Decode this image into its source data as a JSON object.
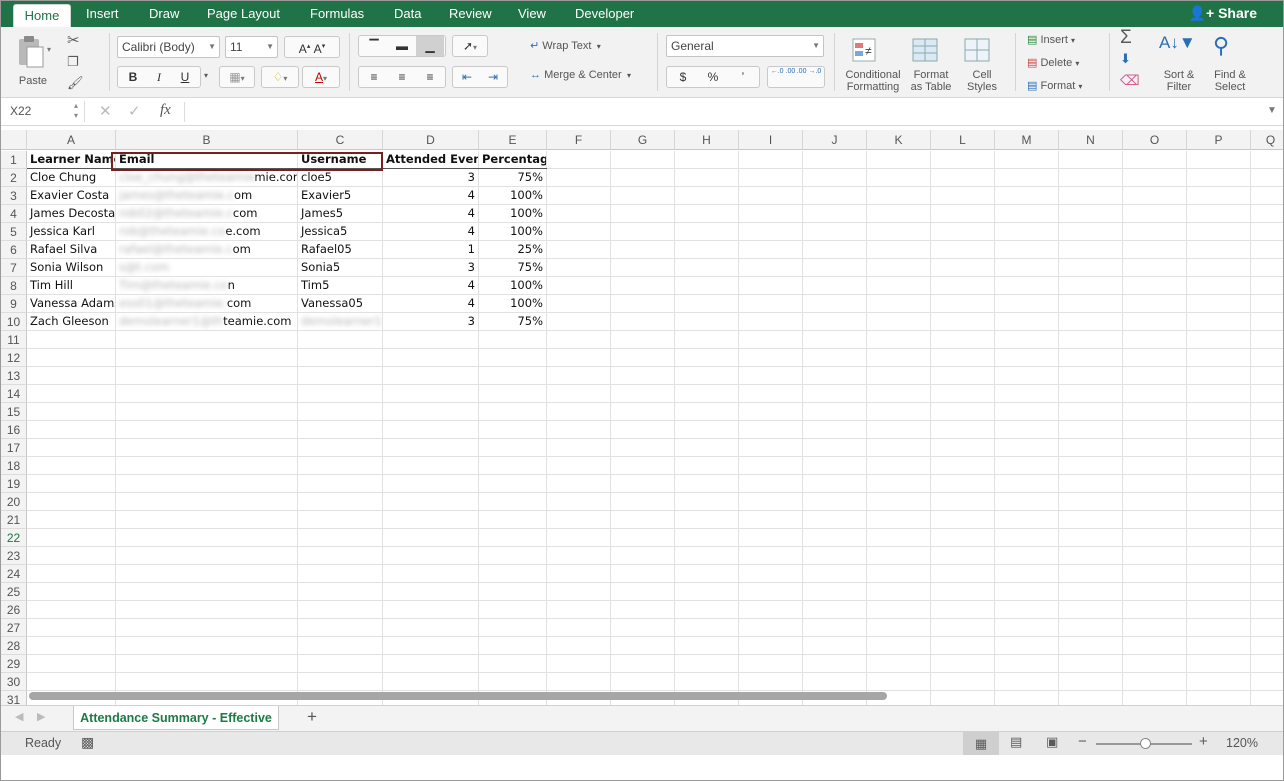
{
  "ribbon_tabs": [
    "Home",
    "Insert",
    "Draw",
    "Page Layout",
    "Formulas",
    "Data",
    "Review",
    "View",
    "Developer"
  ],
  "share_label": "Share",
  "clipboard": {
    "paste_label": "Paste"
  },
  "font": {
    "name": "Calibri (Body)",
    "size": "11"
  },
  "alignment": {
    "wrap_label": "Wrap Text",
    "merge_label": "Merge & Center"
  },
  "number": {
    "format": "General",
    "currency": "$",
    "percent": "%",
    "comma": "ʼ",
    "inc_decimal": "←.0 .00",
    "dec_decimal": ".00 →.0"
  },
  "styles": {
    "conditional_l1": "Conditional",
    "conditional_l2": "Formatting",
    "format_table_l1": "Format",
    "format_table_l2": "as Table",
    "cell_styles_l1": "Cell",
    "cell_styles_l2": "Styles"
  },
  "cells_group": {
    "insert_label": "Insert",
    "delete_label": "Delete",
    "format_label": "Format"
  },
  "editing": {
    "sort_l1": "Sort &",
    "sort_l2": "Filter",
    "find_l1": "Find &",
    "find_l2": "Select"
  },
  "formula_bar": {
    "name_box": "X22",
    "fx": "fx",
    "content": ""
  },
  "columns": [
    "A",
    "B",
    "C",
    "D",
    "E",
    "F",
    "G",
    "H",
    "I",
    "J",
    "K",
    "L",
    "M",
    "N",
    "O",
    "P",
    "Q"
  ],
  "row_numbers": [
    "1",
    "2",
    "3",
    "4",
    "5",
    "6",
    "7",
    "8",
    "9",
    "10",
    "11",
    "12",
    "13",
    "14",
    "15",
    "16",
    "17",
    "18",
    "19",
    "20",
    "21",
    "22",
    "23",
    "24",
    "25",
    "26",
    "27",
    "28",
    "29",
    "30",
    "31"
  ],
  "selected_row": "22",
  "headers": [
    "Learner Name",
    "Email",
    "Username",
    "Attended Events",
    "Percentage"
  ],
  "rows": [
    {
      "name": "Cloe Chung",
      "email_blur": "cloe_chung@theteamie",
      "email_visible": "mie.com",
      "username": "cloe5",
      "events": "3",
      "pct": "75%"
    },
    {
      "name": "Exavier Costa",
      "email_blur": "james@theteamie.c",
      "email_visible": "om",
      "username": "Exavier5",
      "events": "4",
      "pct": "100%"
    },
    {
      "name": "James Decosta",
      "email_blur": "rob02@theteamie.c",
      "email_visible": "com",
      "username": "James5",
      "events": "4",
      "pct": "100%"
    },
    {
      "name": "Jessica Karl",
      "email_blur": "rob@theteamie.co",
      "email_visible": "e.com",
      "username": "Jessica5",
      "events": "4",
      "pct": "100%"
    },
    {
      "name": "Rafael Silva",
      "email_blur": "rafael@theteamie.c",
      "email_visible": "om",
      "username": "Rafael05",
      "events": "1",
      "pct": "25%"
    },
    {
      "name": "Sonia Wilson",
      "email_blur": "s@t.com",
      "email_visible": "",
      "username": "Sonia5",
      "events": "3",
      "pct": "75%"
    },
    {
      "name": "Tim Hill",
      "email_blur": "Tim@theteamie.co",
      "email_visible": "n",
      "username": "Tim5",
      "events": "4",
      "pct": "100%"
    },
    {
      "name": "Vanessa Adams",
      "email_blur": "ess01@theteamie.",
      "email_visible": "com",
      "username": "Vanessa05",
      "events": "4",
      "pct": "100%"
    },
    {
      "name": "Zach Gleeson",
      "email_blur": "demolearner1@th",
      "email_visible": "teamie.com",
      "username_blur": "demolearner1",
      "username": "",
      "events": "3",
      "pct": "75%"
    }
  ],
  "sheet_tab": "Attendance Summary - Effective",
  "status": {
    "ready": "Ready",
    "zoom": "120%"
  },
  "colors": {
    "ribbon_green": "#207346",
    "highlight": "#7a1f1f"
  }
}
